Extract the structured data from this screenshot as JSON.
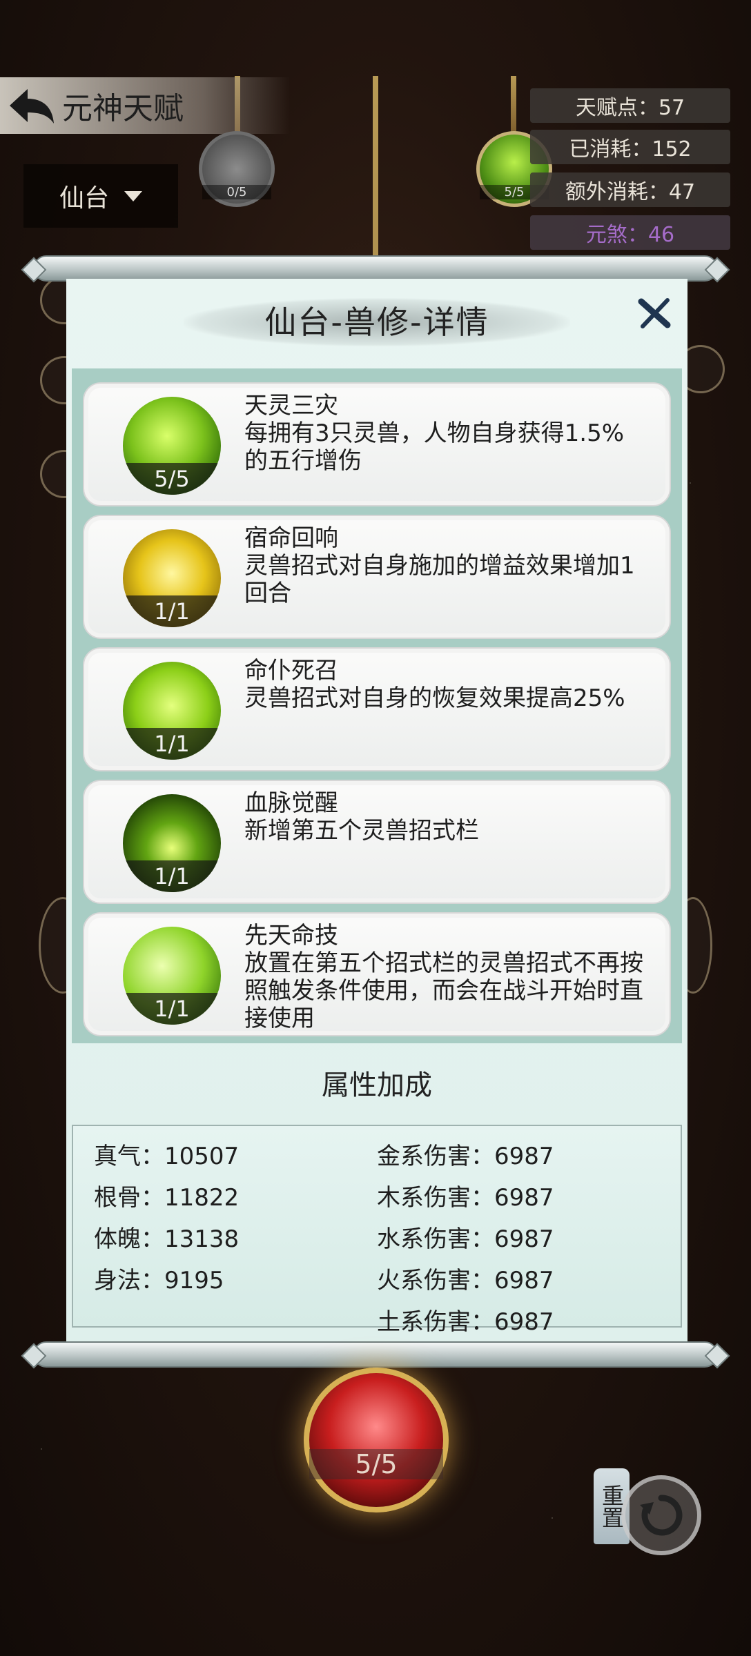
{
  "header": {
    "title": "元神天赋",
    "realm_selected": "仙台"
  },
  "nodes": {
    "top_left_level": "0/5",
    "top_right_level": "5/5",
    "bottom_level": "5/5"
  },
  "stats": {
    "talent_points": "天赋点：57",
    "consumed": "已消耗：152",
    "extra_consumed": "额外消耗：47",
    "yuansha": "元煞：46"
  },
  "panel": {
    "title": "仙台-兽修-详情",
    "talents": [
      {
        "name": "天灵三灾",
        "desc": "每拥有3只灵兽，人物自身获得1.5%的五行增伤",
        "level": "5/5",
        "icon": "green-beasts-icon"
      },
      {
        "name": "宿命回响",
        "desc": "灵兽招式对自身施加的增益效果增加1回合",
        "level": "1/1",
        "icon": "gold-swirl-icon"
      },
      {
        "name": "命仆死召",
        "desc": "灵兽招式对自身的恢复效果提高25%",
        "level": "1/1",
        "icon": "green-cross-icon"
      },
      {
        "name": "血脉觉醒",
        "desc": "新增第五个灵兽招式栏",
        "level": "1/1",
        "icon": "green-flame-icon"
      },
      {
        "name": "先天命技",
        "desc": "放置在第五个招式栏的灵兽招式不再按照触发条件使用，而会在战斗开始时直接使用",
        "level": "1/1",
        "icon": "green-leaf-icon"
      }
    ],
    "attr_title": "属性加成",
    "attrs_left": [
      "真气：10507",
      "根骨：11822",
      "体魄：13138",
      "身法：9195",
      ""
    ],
    "attrs_right": [
      "金系伤害：6987",
      "木系伤害：6987",
      "水系伤害：6987",
      "火系伤害：6987",
      "土系伤害：6987"
    ]
  },
  "reset_label": "重置",
  "colors": {
    "panel_bg": "#e9f5f2",
    "list_frame": "#a8cdc4",
    "purple_stat": "#a56cc9"
  }
}
